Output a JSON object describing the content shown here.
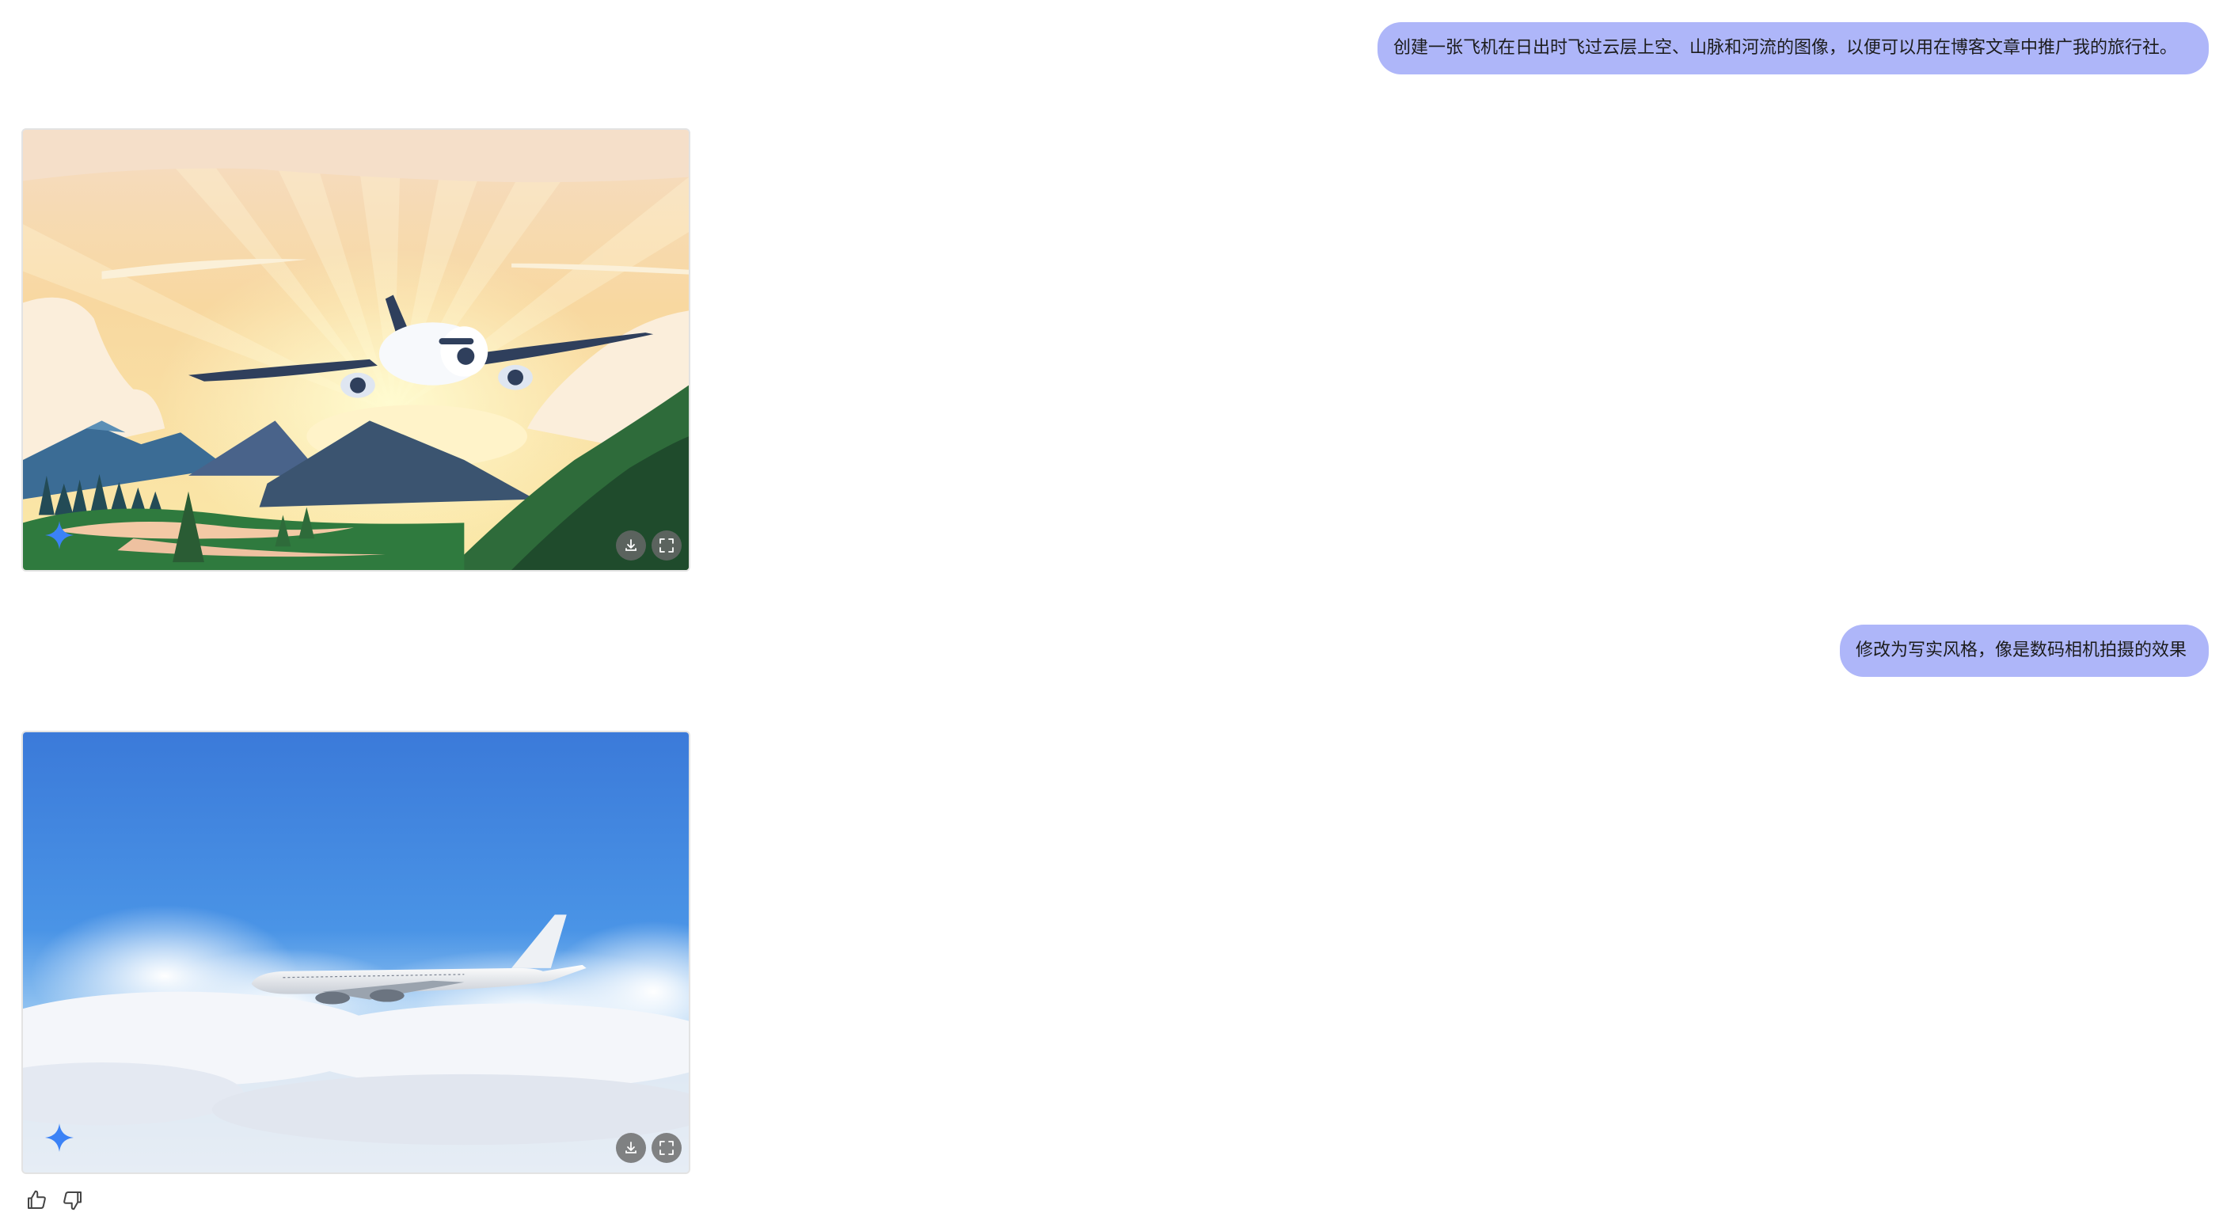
{
  "conversation": {
    "messages": [
      {
        "role": "user",
        "text": "创建一张飞机在日出时飞过云层上空、山脉和河流的图像，以便可以用在博客文章中推广我的旅行社。"
      },
      {
        "role": "assistant",
        "image": "illustrated-airplane-sunrise-mountains-river"
      },
      {
        "role": "user",
        "text": "修改为写实风格，像是数码相机拍摄的效果"
      },
      {
        "role": "assistant",
        "image": "photorealistic-airplane-above-clouds"
      }
    ]
  },
  "image_actions": {
    "download_icon": "download-icon",
    "fullscreen_icon": "fullscreen-icon",
    "badge_icon": "sparkle-icon"
  },
  "feedback": {
    "like_icon": "thumbs-up-icon",
    "dislike_icon": "thumbs-down-icon"
  },
  "colors": {
    "user_bubble": "#aeb6f9",
    "sparkle_badge": "#3b82f6",
    "image_button": "#696969"
  }
}
